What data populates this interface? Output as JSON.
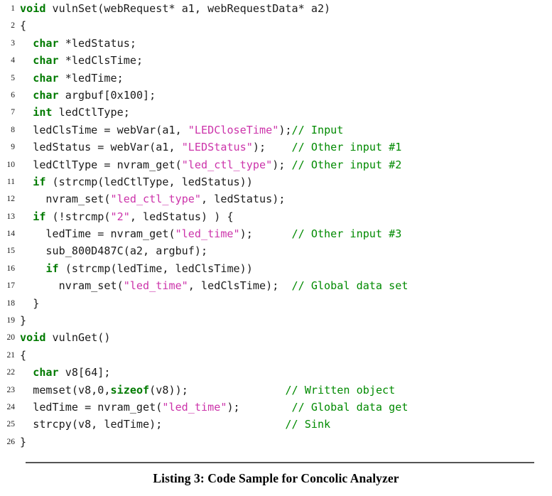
{
  "figure": {
    "caption": "Listing 3: Code Sample for Concolic Analyzer",
    "rule_color": "#555555"
  },
  "syntax_colors": {
    "keyword": "#007a00",
    "string": "#cc33aa",
    "comment": "#008a00",
    "plain": "#1b1b1b",
    "line_number": "#1a1a1a",
    "background": "#ffffff"
  },
  "code": {
    "language": "c",
    "line_count": 26,
    "lines": [
      {
        "number": "1",
        "text": "void vulnSet(webRequest* a1, webRequestData* a2)",
        "tokens": [
          {
            "t": "kw",
            "v": "void"
          },
          {
            "t": "pln",
            "v": " vulnSet(webRequest* a1, webRequestData* a2)"
          }
        ]
      },
      {
        "number": "2",
        "text": "{",
        "tokens": [
          {
            "t": "pln",
            "v": "{"
          }
        ]
      },
      {
        "number": "3",
        "text": "  char *ledStatus;",
        "tokens": [
          {
            "t": "pln",
            "v": "  "
          },
          {
            "t": "kw",
            "v": "char"
          },
          {
            "t": "pln",
            "v": " *ledStatus;"
          }
        ]
      },
      {
        "number": "4",
        "text": "  char *ledClsTime;",
        "tokens": [
          {
            "t": "pln",
            "v": "  "
          },
          {
            "t": "kw",
            "v": "char"
          },
          {
            "t": "pln",
            "v": " *ledClsTime;"
          }
        ]
      },
      {
        "number": "5",
        "text": "  char *ledTime;",
        "tokens": [
          {
            "t": "pln",
            "v": "  "
          },
          {
            "t": "kw",
            "v": "char"
          },
          {
            "t": "pln",
            "v": " *ledTime;"
          }
        ]
      },
      {
        "number": "6",
        "text": "  char argbuf[0x100];",
        "tokens": [
          {
            "t": "pln",
            "v": "  "
          },
          {
            "t": "kw",
            "v": "char"
          },
          {
            "t": "pln",
            "v": " argbuf[0x100];"
          }
        ]
      },
      {
        "number": "7",
        "text": "  int ledCtlType;",
        "tokens": [
          {
            "t": "pln",
            "v": "  "
          },
          {
            "t": "kw",
            "v": "int"
          },
          {
            "t": "pln",
            "v": " ledCtlType;"
          }
        ]
      },
      {
        "number": "8",
        "text": "  ledClsTime = webVar(a1, \"LEDCloseTime\");// Input",
        "tokens": [
          {
            "t": "pln",
            "v": "  ledClsTime = webVar(a1, "
          },
          {
            "t": "str",
            "v": "\"LEDCloseTime\""
          },
          {
            "t": "pln",
            "v": ");"
          },
          {
            "t": "cmt",
            "v": "// Input"
          }
        ]
      },
      {
        "number": "9",
        "text": "  ledStatus = webVar(a1, \"LEDStatus\");    // Other input #1",
        "tokens": [
          {
            "t": "pln",
            "v": "  ledStatus = webVar(a1, "
          },
          {
            "t": "str",
            "v": "\"LEDStatus\""
          },
          {
            "t": "pln",
            "v": ");    "
          },
          {
            "t": "cmt",
            "v": "// Other input #1"
          }
        ]
      },
      {
        "number": "10",
        "text": "  ledCtlType = nvram_get(\"led_ctl_type\"); // Other input #2",
        "tokens": [
          {
            "t": "pln",
            "v": "  ledCtlType = nvram_get("
          },
          {
            "t": "str",
            "v": "\"led_ctl_type\""
          },
          {
            "t": "pln",
            "v": "); "
          },
          {
            "t": "cmt",
            "v": "// Other input #2"
          }
        ]
      },
      {
        "number": "11",
        "text": "  if (strcmp(ledCtlType, ledStatus))",
        "tokens": [
          {
            "t": "pln",
            "v": "  "
          },
          {
            "t": "kw",
            "v": "if"
          },
          {
            "t": "pln",
            "v": " (strcmp(ledCtlType, ledStatus))"
          }
        ]
      },
      {
        "number": "12",
        "text": "    nvram_set(\"led_ctl_type\", ledStatus);",
        "tokens": [
          {
            "t": "pln",
            "v": "    nvram_set("
          },
          {
            "t": "str",
            "v": "\"led_ctl_type\""
          },
          {
            "t": "pln",
            "v": ", ledStatus);"
          }
        ]
      },
      {
        "number": "13",
        "text": "  if (!strcmp(\"2\", ledStatus) ) {",
        "tokens": [
          {
            "t": "pln",
            "v": "  "
          },
          {
            "t": "kw",
            "v": "if"
          },
          {
            "t": "pln",
            "v": " (!strcmp("
          },
          {
            "t": "str",
            "v": "\"2\""
          },
          {
            "t": "pln",
            "v": ", ledStatus) ) {"
          }
        ]
      },
      {
        "number": "14",
        "text": "    ledTime = nvram_get(\"led_time\");      // Other input #3",
        "tokens": [
          {
            "t": "pln",
            "v": "    ledTime = nvram_get("
          },
          {
            "t": "str",
            "v": "\"led_time\""
          },
          {
            "t": "pln",
            "v": ");      "
          },
          {
            "t": "cmt",
            "v": "// Other input #3"
          }
        ]
      },
      {
        "number": "15",
        "text": "    sub_800D487C(a2, argbuf);",
        "tokens": [
          {
            "t": "pln",
            "v": "    sub_800D487C(a2, argbuf);"
          }
        ]
      },
      {
        "number": "16",
        "text": "    if (strcmp(ledTime, ledClsTime))",
        "tokens": [
          {
            "t": "pln",
            "v": "    "
          },
          {
            "t": "kw",
            "v": "if"
          },
          {
            "t": "pln",
            "v": " (strcmp(ledTime, ledClsTime))"
          }
        ]
      },
      {
        "number": "17",
        "text": "      nvram_set(\"led_time\", ledClsTime);  // Global data set",
        "tokens": [
          {
            "t": "pln",
            "v": "      nvram_set("
          },
          {
            "t": "str",
            "v": "\"led_time\""
          },
          {
            "t": "pln",
            "v": ", ledClsTime);  "
          },
          {
            "t": "cmt",
            "v": "// Global data set"
          }
        ]
      },
      {
        "number": "18",
        "text": "  }",
        "tokens": [
          {
            "t": "pln",
            "v": "  }"
          }
        ]
      },
      {
        "number": "19",
        "text": "}",
        "tokens": [
          {
            "t": "pln",
            "v": "}"
          }
        ]
      },
      {
        "number": "20",
        "text": "void vulnGet()",
        "tokens": [
          {
            "t": "kw",
            "v": "void"
          },
          {
            "t": "pln",
            "v": " vulnGet()"
          }
        ]
      },
      {
        "number": "21",
        "text": "{",
        "tokens": [
          {
            "t": "pln",
            "v": "{"
          }
        ]
      },
      {
        "number": "22",
        "text": "  char v8[64];",
        "tokens": [
          {
            "t": "pln",
            "v": "  "
          },
          {
            "t": "kw",
            "v": "char"
          },
          {
            "t": "pln",
            "v": " v8[64];"
          }
        ]
      },
      {
        "number": "23",
        "text": "  memset(v8,0,sizeof(v8));               // Written object",
        "tokens": [
          {
            "t": "pln",
            "v": "  memset(v8,0,"
          },
          {
            "t": "kw",
            "v": "sizeof"
          },
          {
            "t": "pln",
            "v": "(v8));               "
          },
          {
            "t": "cmt",
            "v": "// Written object"
          }
        ]
      },
      {
        "number": "24",
        "text": "  ledTime = nvram_get(\"led_time\");        // Global data get",
        "tokens": [
          {
            "t": "pln",
            "v": "  ledTime = nvram_get("
          },
          {
            "t": "str",
            "v": "\"led_time\""
          },
          {
            "t": "pln",
            "v": ");        "
          },
          {
            "t": "cmt",
            "v": "// Global data get"
          }
        ]
      },
      {
        "number": "25",
        "text": "  strcpy(v8, ledTime);                   // Sink",
        "tokens": [
          {
            "t": "pln",
            "v": "  strcpy(v8, ledTime);                   "
          },
          {
            "t": "cmt",
            "v": "// Sink"
          }
        ]
      },
      {
        "number": "26",
        "text": "}",
        "tokens": [
          {
            "t": "pln",
            "v": "}"
          }
        ]
      }
    ]
  }
}
